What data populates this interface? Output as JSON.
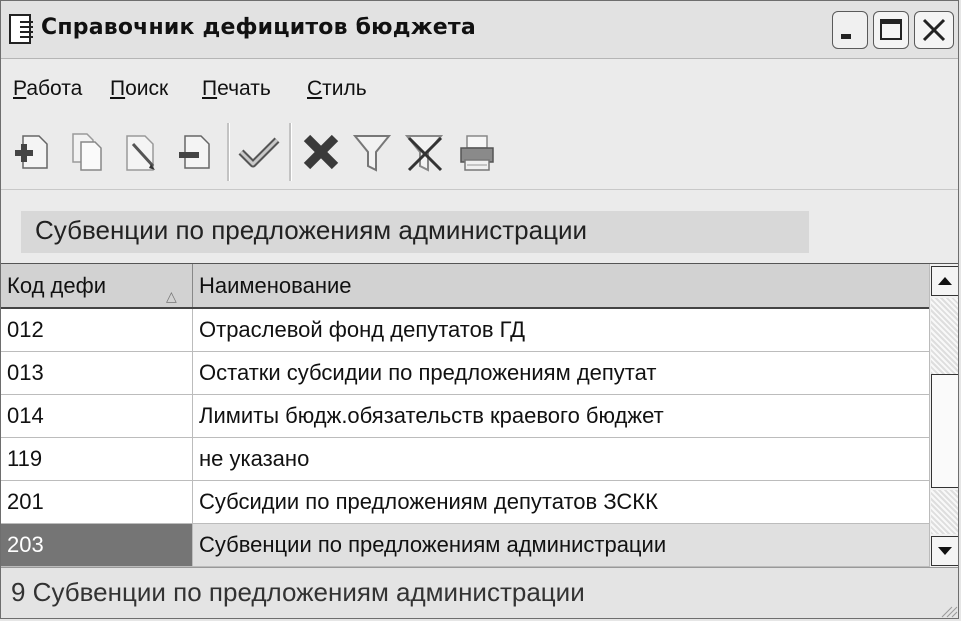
{
  "window": {
    "title": "Справочник дефицитов бюджета"
  },
  "menu": [
    {
      "accel": "Р",
      "rest": "абота"
    },
    {
      "accel": "П",
      "rest": "оиск"
    },
    {
      "accel": "П",
      "rest": "ечать"
    },
    {
      "accel": "С",
      "rest": "тиль"
    }
  ],
  "toolbar": {
    "icons": [
      "add-record-icon",
      "copy-record-icon",
      "edit-record-icon",
      "delete-record-icon",
      "apply-check-icon",
      "cancel-x-icon",
      "filter-icon",
      "clear-filter-icon",
      "print-icon"
    ]
  },
  "caption": "Субвенции по предложениям администрации",
  "grid": {
    "columns": [
      "Код дефи",
      "Наименование"
    ],
    "sort_indicator": "△",
    "rows": [
      {
        "code": "012",
        "name": "Отраслевой фонд депутатов ГД"
      },
      {
        "code": "013",
        "name": "Остатки субсидии по предложениям депутат"
      },
      {
        "code": "014",
        "name": "Лимиты бюдж.обязательств краевого бюджет"
      },
      {
        "code": "119",
        "name": "не указано"
      },
      {
        "code": "201",
        "name": "Субсидии по предложениям депутатов ЗСКК"
      },
      {
        "code": "203",
        "name": "Субвенции по предложениям администрации"
      }
    ],
    "selected_row": 5
  },
  "status": "9 Субвенции по предложениям администрации",
  "colors": {
    "selected_code_bg": "#757575",
    "selected_name_bg": "#e0e0e0",
    "header_bg": "#d2d2d2"
  }
}
